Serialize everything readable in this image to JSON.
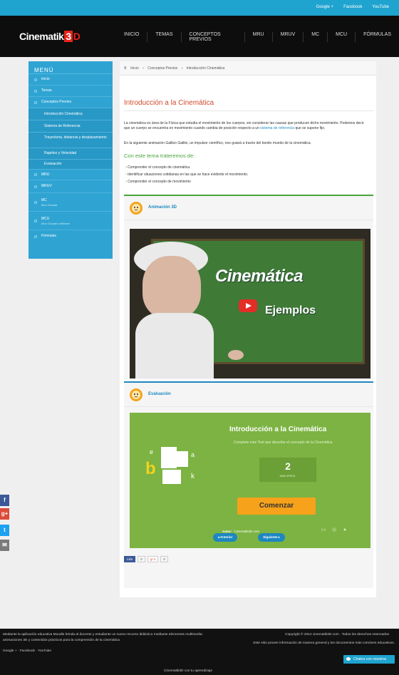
{
  "topbar": {
    "links": [
      "Google +",
      "Facebook",
      "YouTube"
    ]
  },
  "header": {
    "logo": {
      "word": "Cinematik",
      "three": "3",
      "d": "D"
    },
    "nav": [
      "INICIO",
      "TEMAS",
      "CONCEPTOS PREVIOS",
      "MRU",
      "MRUV",
      "MC",
      "MCU",
      "FÓRMULAS"
    ]
  },
  "sidebar": {
    "title": "MENÚ",
    "items": [
      {
        "label": "Inicio"
      },
      {
        "label": "Temas"
      },
      {
        "label": "Conceptos Previos"
      }
    ],
    "subitems": [
      {
        "label": "Introducción Cinemática"
      },
      {
        "label": "Sistema de Referencia"
      },
      {
        "label": "Trayectoria, distancia y desplazamiento"
      },
      {
        "label": "Rapidez y Velocidad"
      },
      {
        "label": "Evaluación"
      }
    ],
    "items2": [
      {
        "label": "MRU"
      },
      {
        "label": "MRUV"
      },
      {
        "label": "MC",
        "small": "Mov Circular"
      },
      {
        "label": "MCU",
        "small": "Mov Circular Uniforme"
      },
      {
        "label": "Fórmulas"
      }
    ]
  },
  "breadcrumb": [
    "Inicio",
    "Conceptos Previos",
    "Introducción Cinemática"
  ],
  "main": {
    "title": "Introducción a la Cinemática",
    "paragraph1": "La cinemática es área de la Física que estudia el movimiento de los cuerpos, sin considerar las causas que producen dicho movimiento. Podemos decir que un cuerpo se encuentra en movimiento cuando cambia de posición respecto a un",
    "paragraph1_link": "sistema de referencia",
    "paragraph1_end": "que se supone fijo.",
    "paragraph2": "En la siguiente animación Galileo Galilei, un impulsor científico, nos guiará a través del bonito mundo de la cinemática.",
    "subheading": "Con este tema trateremos de:",
    "bullets": [
      "Comprender el concepto de cinemática.",
      "Identificar situaciones cotidianas en las que se hace evidente el movimiento.",
      "Comprender el concepto de movimiento"
    ]
  },
  "animation_panel": {
    "label": "Animación 3D",
    "video_title": "Cinemática",
    "video_subtitle": "Ejemplos",
    "accent": "#4aa33c"
  },
  "evaluation_panel": {
    "label": "Evaluación",
    "accent": "#1e87bf",
    "quiz": {
      "title": "Introducción a la Cinemática",
      "subtitle": "Complete este Test que describe el concepto de la Cinemática",
      "minutes": "2",
      "minutes_label": "MINS APROX.",
      "start_label": "Comenzar",
      "author_label": "Autor:",
      "author": "Cinematik3D.com"
    }
  },
  "pager": {
    "prev": "Anterior",
    "next": "Siguiente"
  },
  "share": {
    "like": "Like",
    "like_count": "0",
    "gplus": "g+1",
    "gplus_count": "0"
  },
  "social_side": [
    "f",
    "g+",
    "t",
    "✉"
  ],
  "footer": {
    "about": "Mediante la aplicación educativa Moodle brinda al docente y estudiante un nuevo recurso didáctico mediante elementos multimedia: animaciones 3D y contenidos prácticos para la comprensión de la cinemática.",
    "links": [
      "Google +",
      "Facebook",
      "YouTube"
    ],
    "copyright": "Copyright © 2014 cinematik3D.com . Todos los derechos reservados",
    "right_text": "Este sitio provee información de manera general y los documentos más comúnes educativos.",
    "bottom": "Cinematik3D con tu aprendizaje",
    "chat": "Chatea con nosotros"
  }
}
